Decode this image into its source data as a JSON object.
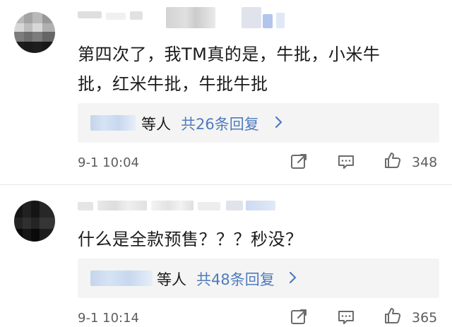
{
  "comments": [
    {
      "text_line1": "第四次了，我TM真的是，牛批，小米牛",
      "text_line2": "批，红米牛批，牛批牛批",
      "reply_people": "等人",
      "reply_total": "共26条回复",
      "time": "9-1 10:04",
      "likes": "348"
    },
    {
      "text": "什么是全款预售？？？秒没？",
      "reply_people": "等人",
      "reply_total": "共48条回复",
      "time": "9-1 10:14",
      "likes": "365"
    }
  ],
  "colors": {
    "link_blue": "#4f7bbd",
    "divider": "#e8e8e8",
    "reply_bg": "#f4f4f4",
    "meta_gray": "#5e5e5e"
  },
  "icons": {
    "share": "share-icon",
    "comment": "comment-icon",
    "like": "like-icon",
    "chevron": "chevron-right-icon"
  }
}
